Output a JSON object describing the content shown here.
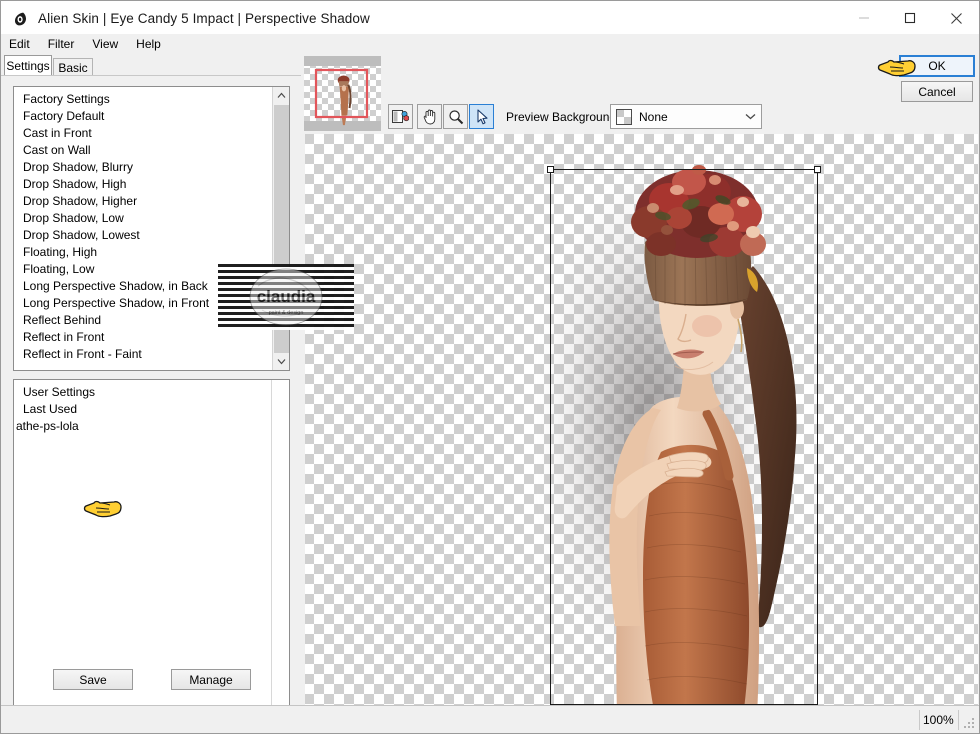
{
  "window": {
    "title": "Alien Skin | Eye Candy 5 Impact | Perspective Shadow",
    "app_icon": "eye-drop-icon",
    "minimize_label": "–",
    "maximize_label": "□",
    "close_label": "×"
  },
  "menubar": {
    "items": [
      {
        "label": "Edit"
      },
      {
        "label": "Filter"
      },
      {
        "label": "View"
      },
      {
        "label": "Help"
      }
    ]
  },
  "tabs": [
    {
      "label": "Settings",
      "active": true
    },
    {
      "label": "Basic",
      "active": false
    }
  ],
  "factory_settings": {
    "header": "Factory Settings",
    "items": [
      "Factory Default",
      "Cast in Front",
      "Cast on Wall",
      "Drop Shadow, Blurry",
      "Drop Shadow, High",
      "Drop Shadow, Higher",
      "Drop Shadow, Low",
      "Drop Shadow, Lowest",
      "Floating, High",
      "Floating, Low",
      "Long Perspective Shadow, in Back",
      "Long Perspective Shadow, in Front",
      "Reflect Behind",
      "Reflect in Front",
      "Reflect in Front - Faint"
    ]
  },
  "user_settings": {
    "header": "User Settings",
    "items": [
      {
        "label": "Last Used",
        "selected": false
      },
      {
        "label": "athe-ps-lola",
        "selected": true
      }
    ]
  },
  "panel_buttons": {
    "save_label": "Save",
    "manage_label": "Manage"
  },
  "toolbar": {
    "thumbnail_name": "preview-navigator-thumbnail",
    "tools": [
      {
        "name": "compare-preview-icon",
        "active": false
      },
      {
        "name": "hand-pan-icon",
        "active": false
      },
      {
        "name": "magnifier-zoom-icon",
        "active": false
      },
      {
        "name": "arrow-select-icon",
        "active": true
      }
    ],
    "preview_background_label": "Preview Background:",
    "preview_background_value": "None",
    "preview_background_swatch": "checkerboard-swatch"
  },
  "dialog_buttons": {
    "ok_label": "OK",
    "cancel_label": "Cancel"
  },
  "statusbar": {
    "zoom_level": "100%"
  },
  "watermark": {
    "text": "claudia",
    "subtext": "paint & design"
  },
  "colors": {
    "accent_blue": "#2a7fd4",
    "selection_blue": "#1a7fe0",
    "panel_gray": "#f0f0f0",
    "border_gray": "#9a9a9a",
    "checker_light": "#ffffff",
    "checker_dark": "#cfcfcf",
    "cursor_yellow": "#f5c518"
  }
}
